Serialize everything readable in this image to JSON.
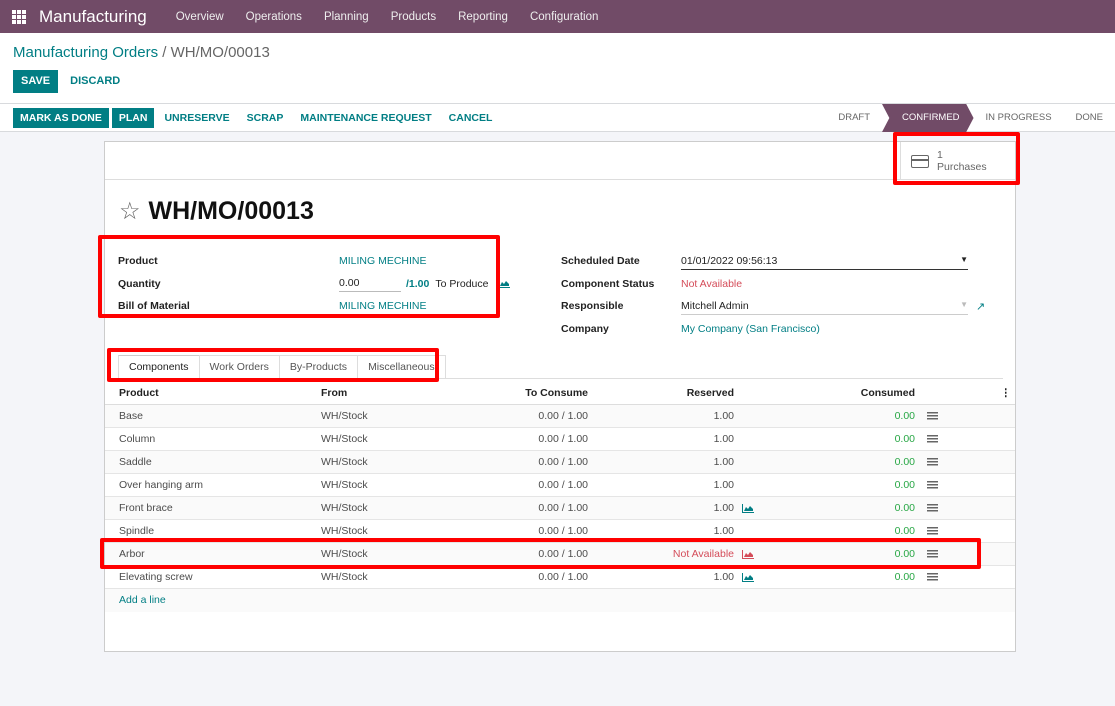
{
  "navbar": {
    "app_name": "Manufacturing",
    "menu": [
      "Overview",
      "Operations",
      "Planning",
      "Products",
      "Reporting",
      "Configuration"
    ]
  },
  "breadcrumb": {
    "parent": "Manufacturing Orders",
    "separator": "/",
    "current": "WH/MO/00013"
  },
  "actions": {
    "save": "SAVE",
    "discard": "DISCARD"
  },
  "status_buttons": {
    "mark_as_done": "MARK AS DONE",
    "plan": "PLAN",
    "unreserve": "UNRESERVE",
    "scrap": "SCRAP",
    "maintenance_request": "MAINTENANCE REQUEST",
    "cancel": "CANCEL"
  },
  "stages": [
    {
      "label": "DRAFT",
      "active": false
    },
    {
      "label": "CONFIRMED",
      "active": true
    },
    {
      "label": "IN PROGRESS",
      "active": false
    },
    {
      "label": "DONE",
      "active": false
    }
  ],
  "smart_button": {
    "count": "1",
    "label": "Purchases",
    "icon": "credit-card-icon"
  },
  "record": {
    "name": "WH/MO/00013",
    "product_label": "Product",
    "product": "MILING MECHINE",
    "quantity_label": "Quantity",
    "quantity_produced": "0.00",
    "quantity_total": "/1.00",
    "to_produce": "To Produce",
    "bom_label": "Bill of Material",
    "bom": "MILING MECHINE",
    "scheduled_date_label": "Scheduled Date",
    "scheduled_date": "01/01/2022 09:56:13",
    "component_status_label": "Component Status",
    "component_status": "Not Available",
    "responsible_label": "Responsible",
    "responsible": "Mitchell Admin",
    "company_label": "Company",
    "company": "My Company (San Francisco)"
  },
  "tabs": [
    {
      "label": "Components",
      "active": true
    },
    {
      "label": "Work Orders",
      "active": false
    },
    {
      "label": "By-Products",
      "active": false
    },
    {
      "label": "Miscellaneous",
      "active": false
    }
  ],
  "table": {
    "headers": {
      "product": "Product",
      "from": "From",
      "to_consume": "To Consume",
      "reserved": "Reserved",
      "consumed": "Consumed"
    },
    "rows": [
      {
        "product": "Base",
        "from": "WH/Stock",
        "to_consume": "0.00 / 1.00",
        "reserved": "1.00",
        "forecast_icon": false,
        "not_available": false,
        "consumed": "0.00"
      },
      {
        "product": "Column",
        "from": "WH/Stock",
        "to_consume": "0.00 / 1.00",
        "reserved": "1.00",
        "forecast_icon": false,
        "not_available": false,
        "consumed": "0.00"
      },
      {
        "product": "Saddle",
        "from": "WH/Stock",
        "to_consume": "0.00 / 1.00",
        "reserved": "1.00",
        "forecast_icon": false,
        "not_available": false,
        "consumed": "0.00"
      },
      {
        "product": "Over hanging arm",
        "from": "WH/Stock",
        "to_consume": "0.00 / 1.00",
        "reserved": "1.00",
        "forecast_icon": false,
        "not_available": false,
        "consumed": "0.00"
      },
      {
        "product": "Front brace",
        "from": "WH/Stock",
        "to_consume": "0.00 / 1.00",
        "reserved": "1.00",
        "forecast_icon": true,
        "not_available": false,
        "consumed": "0.00"
      },
      {
        "product": "Spindle",
        "from": "WH/Stock",
        "to_consume": "0.00 / 1.00",
        "reserved": "1.00",
        "forecast_icon": false,
        "not_available": false,
        "consumed": "0.00"
      },
      {
        "product": "Arbor",
        "from": "WH/Stock",
        "to_consume": "0.00 / 1.00",
        "reserved": "Not Available",
        "forecast_icon": true,
        "not_available": true,
        "consumed": "0.00"
      },
      {
        "product": "Elevating screw",
        "from": "WH/Stock",
        "to_consume": "0.00 / 1.00",
        "reserved": "1.00",
        "forecast_icon": true,
        "not_available": false,
        "consumed": "0.00"
      }
    ],
    "add_line": "Add a line"
  },
  "colors": {
    "brand": "#714b67",
    "primary": "#017e84",
    "danger": "#d44c59",
    "success": "#28a745",
    "highlight": "#ff0000"
  }
}
